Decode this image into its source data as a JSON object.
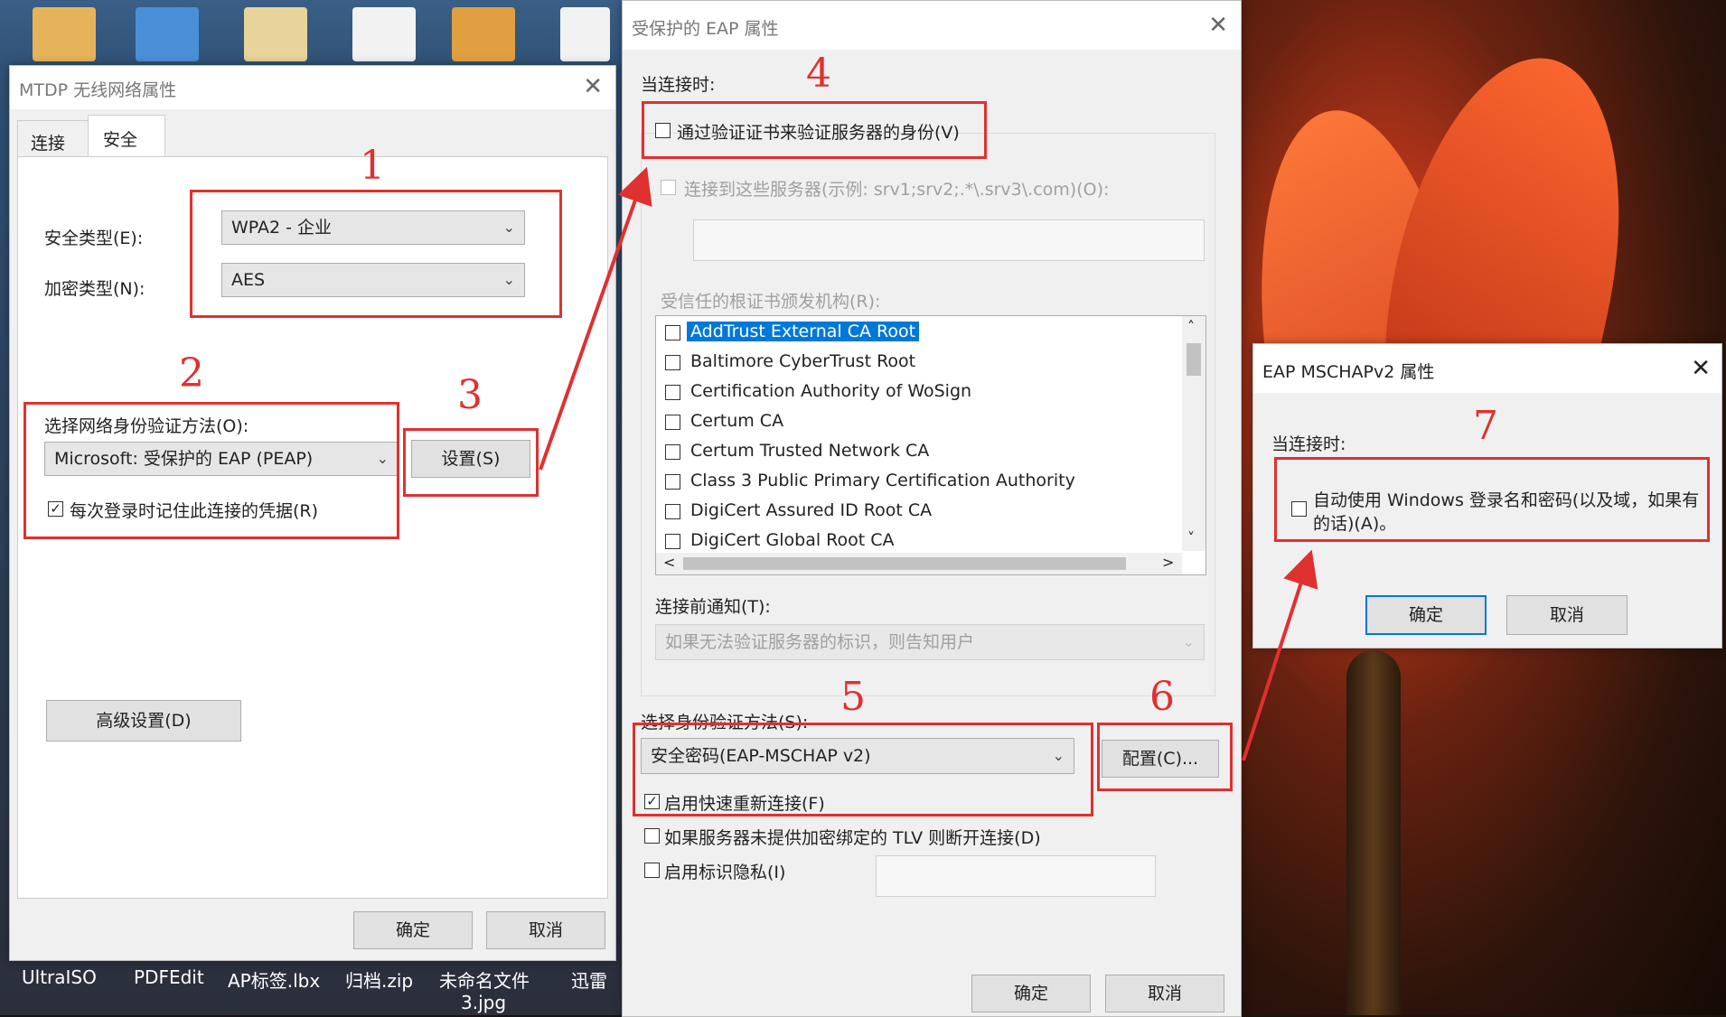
{
  "desktop": {
    "taskbar_labels": [
      "UltraISO",
      "PDFEdit",
      "AP标签.lbx",
      "归档.zip",
      "未命名文件",
      "3.jpg",
      "迅雷"
    ]
  },
  "wifi_props": {
    "title": "MTDP 无线网络属性",
    "tabs": [
      "连接",
      "安全"
    ],
    "security_type_label": "安全类型(E):",
    "security_type_value": "WPA2 - 企业",
    "encryption_type_label": "加密类型(N):",
    "encryption_type_value": "AES",
    "auth_method_label": "选择网络身份验证方法(O):",
    "auth_method_value": "Microsoft: 受保护的 EAP (PEAP)",
    "settings_button": "设置(S)",
    "remember_credentials": "每次登录时记住此连接的凭据(R)",
    "advanced_button": "高级设置(D)",
    "ok_button": "确定",
    "cancel_button": "取消"
  },
  "peap_props": {
    "title": "受保护的 EAP 属性",
    "when_connecting": "当连接时:",
    "verify_cert": "通过验证证书来验证服务器的身份(V)",
    "connect_to_servers": "连接到这些服务器(示例: srv1;srv2;.*\\.srv3\\.com)(O):",
    "trusted_roots_label": "受信任的根证书颁发机构(R):",
    "trusted_roots": [
      "AddTrust External CA Root",
      "Baltimore CyberTrust Root",
      "Certification Authority of WoSign",
      "Certum CA",
      "Certum Trusted Network CA",
      "Class 3 Public Primary Certification Authority",
      "DigiCert Assured ID Root CA",
      "DigiCert Global Root CA"
    ],
    "notify_label": "连接前通知(T):",
    "notify_value": "如果无法验证服务器的标识，则告知用户",
    "select_auth_label": "选择身份验证方法(S):",
    "auth_method_value": "安全密码(EAP-MSCHAP v2)",
    "configure_button": "配置(C)...",
    "fast_reconnect": "启用快速重新连接(F)",
    "disconnect_tlv": "如果服务器未提供加密绑定的 TLV 则断开连接(D)",
    "identity_privacy": "启用标识隐私(I)",
    "ok_button": "确定",
    "cancel_button": "取消"
  },
  "mschap_props": {
    "title": "EAP MSCHAPv2 属性",
    "when_connecting": "当连接时:",
    "auto_use_windows_line1": "自动使用 Windows 登录名和密码(以及域，如果有",
    "auto_use_windows_line2": "的话)(A)。",
    "ok_button": "确定",
    "cancel_button": "取消"
  },
  "annotations": {
    "step_numbers": [
      "1",
      "2",
      "3",
      "4",
      "5",
      "6",
      "7"
    ],
    "accent_color": "#e03030"
  },
  "icons": {
    "dropdown": "chevron-down-icon",
    "close": "close-icon",
    "check": "✓",
    "scroll_up": "˄",
    "scroll_down": "˅",
    "scroll_left": "<",
    "scroll_right": ">"
  }
}
